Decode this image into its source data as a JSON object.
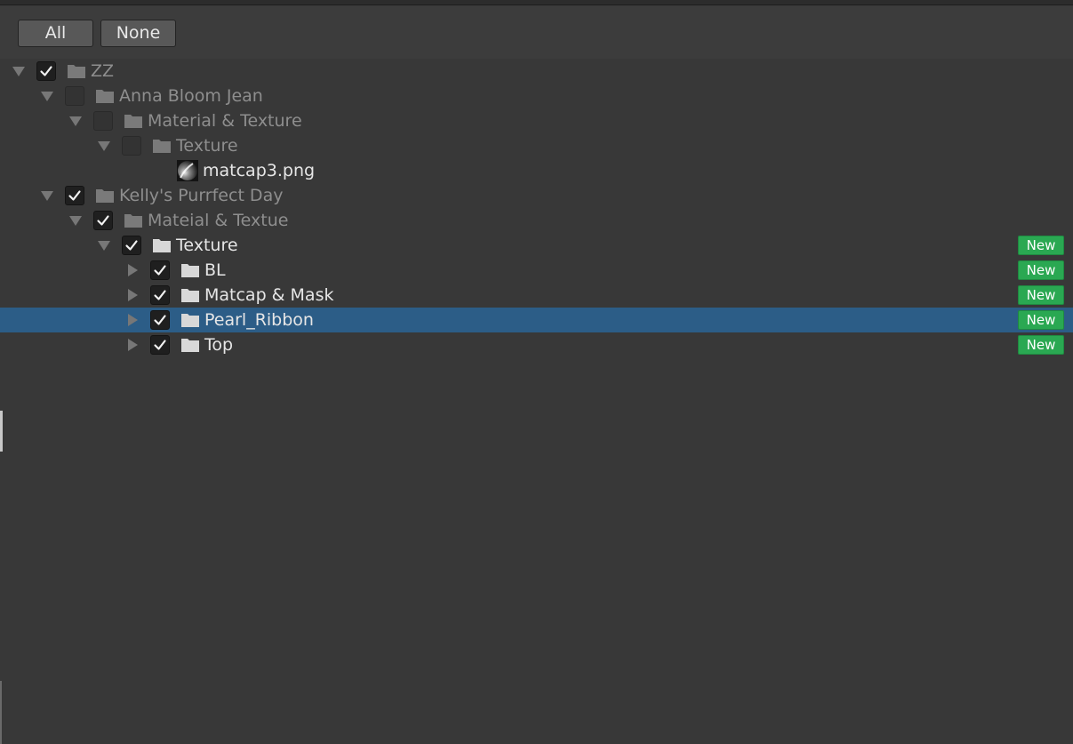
{
  "toolbar": {
    "all_label": "All",
    "none_label": "None"
  },
  "tree": {
    "items": [
      {
        "label": "ZZ",
        "type": "folder",
        "depth": 0,
        "expanded": true,
        "checked": true,
        "dim": true,
        "badge": ""
      },
      {
        "label": "Anna Bloom Jean",
        "type": "folder",
        "depth": 1,
        "expanded": true,
        "checked": false,
        "dim": true,
        "badge": ""
      },
      {
        "label": "Material & Texture",
        "type": "folder",
        "depth": 2,
        "expanded": true,
        "checked": false,
        "dim": true,
        "badge": ""
      },
      {
        "label": "Texture",
        "type": "folder",
        "depth": 3,
        "expanded": true,
        "checked": false,
        "dim": true,
        "badge": ""
      },
      {
        "label": "matcap3.png",
        "type": "file",
        "depth": 4,
        "checked": false,
        "dim": false,
        "badge": ""
      },
      {
        "label": "Kelly's Purrfect Day",
        "type": "folder",
        "depth": 1,
        "expanded": true,
        "checked": true,
        "dim": true,
        "badge": ""
      },
      {
        "label": "Mateial & Textue",
        "type": "folder",
        "depth": 2,
        "expanded": true,
        "checked": true,
        "dim": true,
        "badge": ""
      },
      {
        "label": "Texture",
        "type": "folder",
        "depth": 3,
        "expanded": true,
        "checked": true,
        "dim": false,
        "badge": "New"
      },
      {
        "label": "BL",
        "type": "folder",
        "depth": 4,
        "expanded": false,
        "checked": true,
        "dim": false,
        "badge": "New"
      },
      {
        "label": "Matcap & Mask",
        "type": "folder",
        "depth": 4,
        "expanded": false,
        "checked": true,
        "dim": false,
        "badge": "New"
      },
      {
        "label": "Pearl_Ribbon",
        "type": "folder",
        "depth": 4,
        "expanded": false,
        "checked": true,
        "dim": false,
        "selected": true,
        "badge": "New"
      },
      {
        "label": "Top",
        "type": "folder",
        "depth": 4,
        "expanded": false,
        "checked": true,
        "dim": false,
        "badge": "New"
      }
    ]
  },
  "colors": {
    "background": "#383838",
    "selection": "#2c5d87",
    "badge_green": "#2aa852",
    "text": "#e6e6e6",
    "text_dim": "#8e8e8e"
  },
  "icons": {
    "expand_open": "triangle-down-icon",
    "expand_closed": "triangle-right-icon",
    "check": "checkmark-icon",
    "folder": "folder-icon",
    "image": "image-thumbnail-icon"
  }
}
